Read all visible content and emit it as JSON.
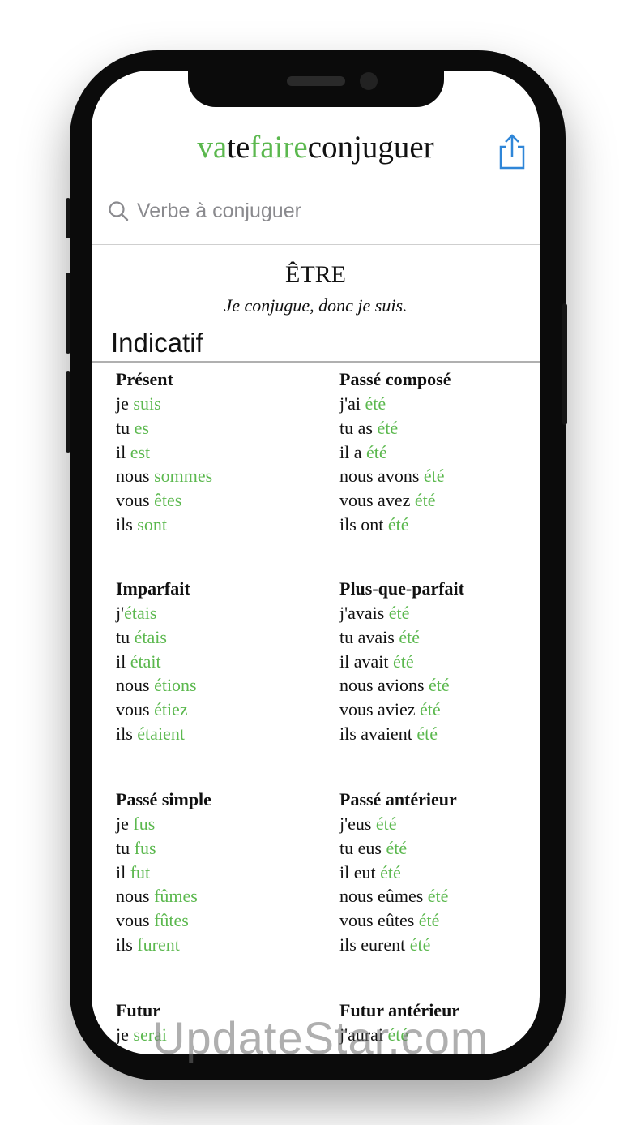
{
  "app": {
    "title_parts": [
      {
        "text": "va",
        "accent": true
      },
      {
        "text": "te",
        "accent": false
      },
      {
        "text": "faire",
        "accent": true
      },
      {
        "text": "conjuguer",
        "accent": false
      }
    ],
    "share_icon": "share-icon"
  },
  "search": {
    "placeholder": "Verbe à conjuguer",
    "value": "",
    "icon": "search-icon"
  },
  "verb": {
    "infinitive": "ÊTRE",
    "motto": "Je conjugue, donc je suis."
  },
  "mood": {
    "name": "Indicatif",
    "tenses": [
      {
        "name": "Présent",
        "lines": [
          {
            "pronoun": "je ",
            "form": "suis"
          },
          {
            "pronoun": "tu ",
            "form": "es"
          },
          {
            "pronoun": "il ",
            "form": "est"
          },
          {
            "pronoun": "nous ",
            "form": "sommes"
          },
          {
            "pronoun": "vous ",
            "form": "êtes"
          },
          {
            "pronoun": "ils ",
            "form": "sont"
          }
        ]
      },
      {
        "name": "Passé composé",
        "lines": [
          {
            "pronoun": "j'ai ",
            "form": "été"
          },
          {
            "pronoun": "tu as ",
            "form": "été"
          },
          {
            "pronoun": "il a ",
            "form": "été"
          },
          {
            "pronoun": "nous avons ",
            "form": "été"
          },
          {
            "pronoun": "vous avez ",
            "form": "été"
          },
          {
            "pronoun": "ils ont ",
            "form": "été"
          }
        ]
      },
      {
        "name": "Imparfait",
        "lines": [
          {
            "pronoun": "j'",
            "form": "étais"
          },
          {
            "pronoun": "tu ",
            "form": "étais"
          },
          {
            "pronoun": "il ",
            "form": "était"
          },
          {
            "pronoun": "nous ",
            "form": "étions"
          },
          {
            "pronoun": "vous ",
            "form": "étiez"
          },
          {
            "pronoun": "ils ",
            "form": "étaient"
          }
        ]
      },
      {
        "name": "Plus-que-parfait",
        "lines": [
          {
            "pronoun": "j'avais ",
            "form": "été"
          },
          {
            "pronoun": "tu avais ",
            "form": "été"
          },
          {
            "pronoun": "il avait ",
            "form": "été"
          },
          {
            "pronoun": "nous avions ",
            "form": "été"
          },
          {
            "pronoun": "vous aviez ",
            "form": "été"
          },
          {
            "pronoun": "ils avaient ",
            "form": "été"
          }
        ]
      },
      {
        "name": "Passé simple",
        "lines": [
          {
            "pronoun": "je ",
            "form": "fus"
          },
          {
            "pronoun": "tu ",
            "form": "fus"
          },
          {
            "pronoun": "il ",
            "form": "fut"
          },
          {
            "pronoun": "nous ",
            "form": "fûmes"
          },
          {
            "pronoun": "vous ",
            "form": "fûtes"
          },
          {
            "pronoun": "ils ",
            "form": "furent"
          }
        ]
      },
      {
        "name": "Passé antérieur",
        "lines": [
          {
            "pronoun": "j'eus ",
            "form": "été"
          },
          {
            "pronoun": "tu eus ",
            "form": "été"
          },
          {
            "pronoun": "il eut ",
            "form": "été"
          },
          {
            "pronoun": "nous eûmes ",
            "form": "été"
          },
          {
            "pronoun": "vous eûtes ",
            "form": "été"
          },
          {
            "pronoun": "ils eurent ",
            "form": "été"
          }
        ]
      },
      {
        "name": "Futur",
        "lines": [
          {
            "pronoun": "je ",
            "form": "serai"
          }
        ]
      },
      {
        "name": "Futur antérieur",
        "lines": [
          {
            "pronoun": "j'aurai ",
            "form": "été"
          }
        ]
      }
    ]
  },
  "watermark": "UpdateStar.com",
  "colors": {
    "accent": "#5bb84e",
    "ios_blue": "#2f86d8",
    "text": "#111111",
    "device": "#0b0b0b"
  }
}
